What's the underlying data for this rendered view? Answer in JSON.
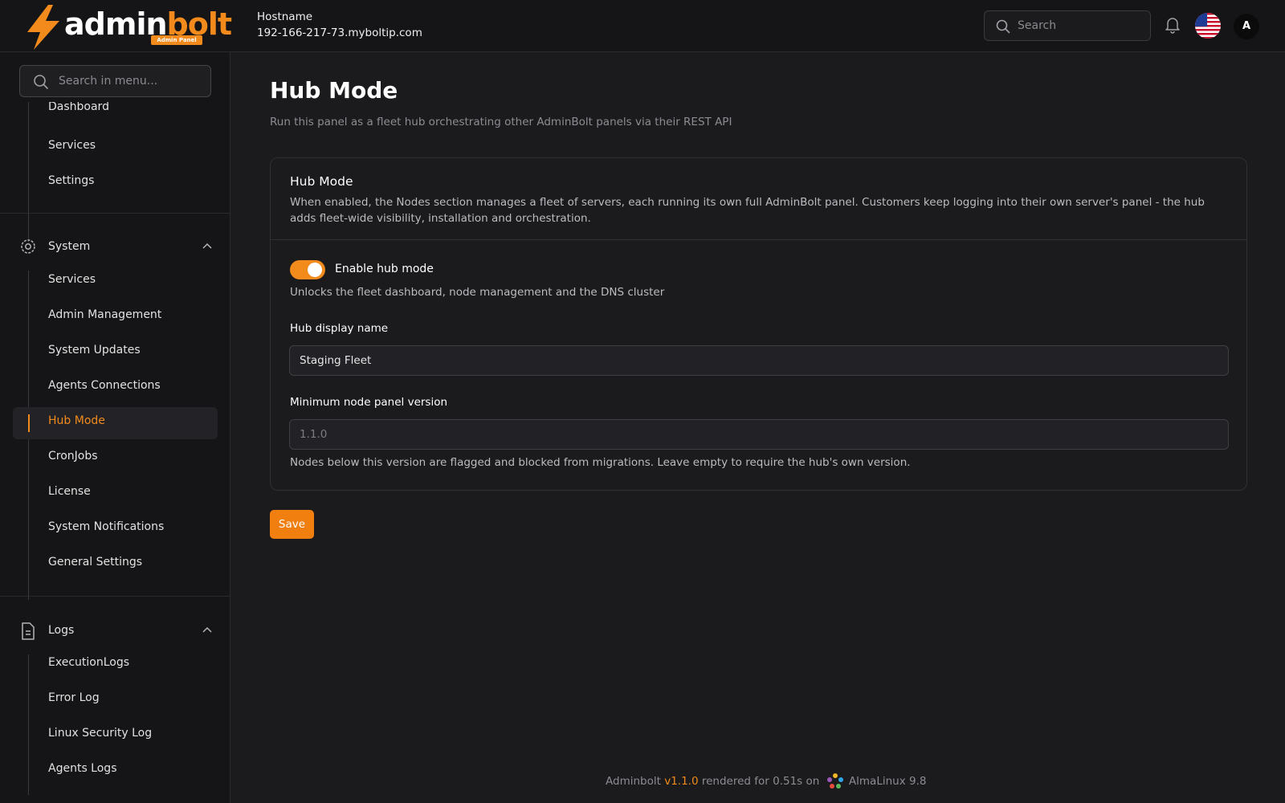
{
  "header": {
    "brand_word1": "admin",
    "brand_word2": "bolt",
    "brand_badge": "Admin Panel",
    "hostname_label": "Hostname",
    "hostname_value": "192-166-217-73.myboltip.com",
    "search_placeholder": "Search",
    "avatar_initial": "A",
    "accent_color": "#f28a1c"
  },
  "sidebar": {
    "search_placeholder": "Search in menu...",
    "top_items": [
      "Dashboard",
      "Services",
      "Settings"
    ],
    "system": {
      "label": "System",
      "items": [
        "Services",
        "Admin Management",
        "System Updates",
        "Agents Connections",
        "Hub Mode",
        "CronJobs",
        "License",
        "System Notifications",
        "General Settings"
      ],
      "active": "Hub Mode"
    },
    "logs": {
      "label": "Logs",
      "items": [
        "ExecutionLogs",
        "Error Log",
        "Linux Security Log",
        "Agents Logs"
      ]
    }
  },
  "main": {
    "title": "Hub Mode",
    "subtitle": "Run this panel as a fleet hub orchestrating other AdminBolt panels via their REST API",
    "card": {
      "title": "Hub Mode",
      "description": "When enabled, the Nodes section manages a fleet of servers, each running its own full AdminBolt panel. Customers keep logging into their own server's panel - the hub adds fleet-wide visibility, installation and orchestration.",
      "toggle_label": "Enable hub mode",
      "toggle_on": true,
      "toggle_help": "Unlocks the fleet dashboard, node management and the DNS cluster",
      "display_name_label": "Hub display name",
      "display_name_value": "Staging Fleet",
      "min_version_label": "Minimum node panel version",
      "min_version_placeholder": "1.1.0",
      "min_version_help": "Nodes below this version are flagged and blocked from migrations. Leave empty to require the hub's own version."
    },
    "save_label": "Save"
  },
  "footer": {
    "brand": "Adminbolt",
    "version": "v1.1.0",
    "rendered_text": "rendered for 0.51s on",
    "os": "AlmaLinux 9.8"
  }
}
